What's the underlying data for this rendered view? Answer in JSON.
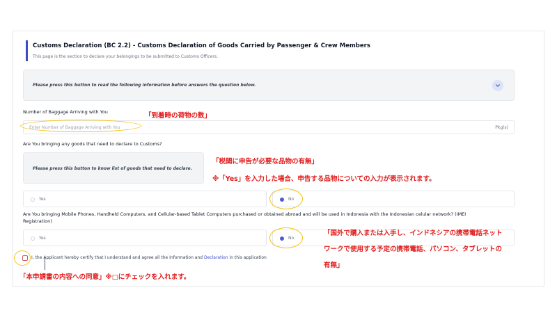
{
  "section": {
    "title": "Customs Declaration (BC 2.2) - Customs Declaration of Goods Carried by Passenger & Crew Members",
    "subtitle": "This page is the section to declare your belongings to be submitted to Customs Officers."
  },
  "info_panel": {
    "text": "Please press this button to read the following information before answers the question below."
  },
  "baggage": {
    "label": "Number of Baggage Arriving with You",
    "placeholder": "Enter Number of Baggage Arriving with You",
    "unit": "Pkg(s)"
  },
  "declare_goods": {
    "question": "Are You bringing any goods that need to declare to Customs?",
    "info_text": "Please press this button to know list of goods that need to declare.",
    "options": [
      "Yes",
      "No"
    ],
    "selected": "No"
  },
  "imei": {
    "question_line1": "Are You bringing Mobile Phones, Handheld Computers, and Cellular-based Tablet Computers purchased or obtained abroad and will be used in Indonesia with the Indonesian celular network? (IMEI",
    "question_line2": "Registration)",
    "options": [
      "Yes",
      "No"
    ],
    "selected": "No"
  },
  "certification": {
    "text_before": "I, the Applicant hereby certify that I understand and agree all the Information and ",
    "link": "Declaration",
    "text_after": " in this application"
  },
  "annotations": {
    "baggage": "「到着時の荷物の数」",
    "customs_line1": "「税関に申告が必要な品物の有無」",
    "customs_line2": "※「Yes」を入力した場合、申告する品物についての入力が表示されます。",
    "imei_line1": "「国外で購入または入手し、インドネシアの携帯電話ネット",
    "imei_line2": "ワークで使用する予定の携帯電話、パソコン、タブレットの",
    "imei_line3": "有無」",
    "consent": "「本申請書の内容への同意」※□にチェックを入れます。"
  },
  "colors": {
    "accent": "#3b4ec8",
    "annotation_red": "#e21b1b",
    "highlight_yellow": "#f5c518"
  }
}
